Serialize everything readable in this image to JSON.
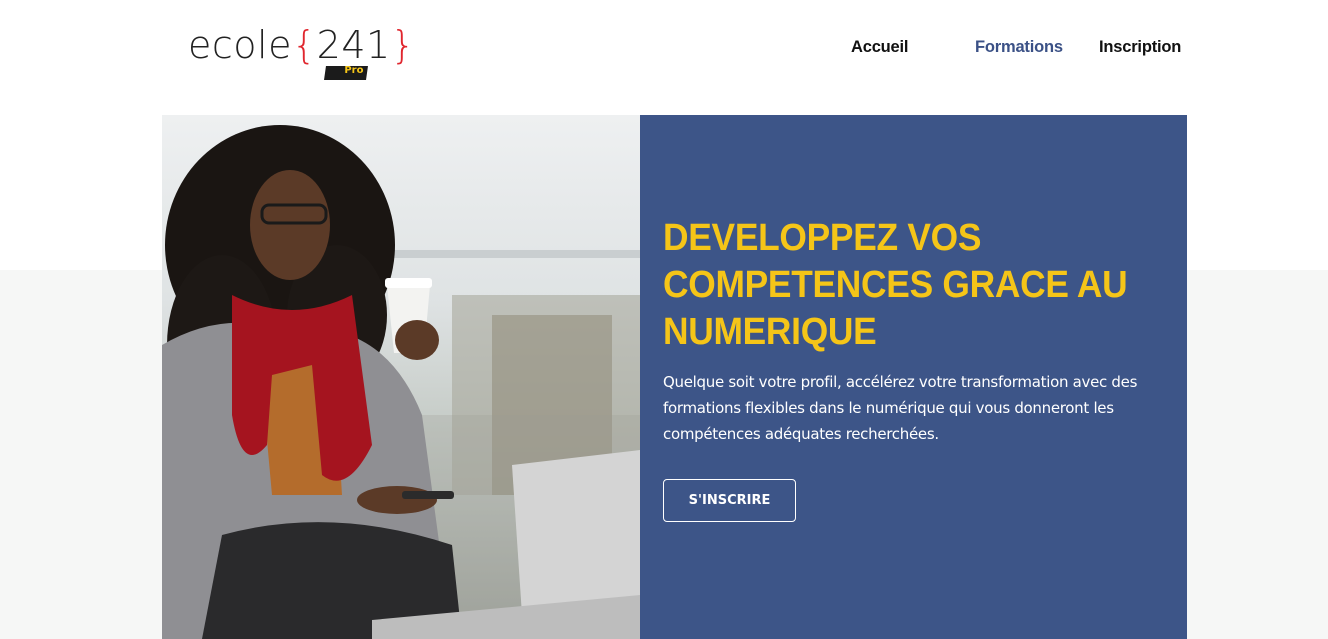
{
  "logo": {
    "word": "ecole",
    "brace_open": "{",
    "number": "241",
    "brace_close": "}",
    "badge": "Pro"
  },
  "nav": {
    "items": [
      {
        "label": "Accueil"
      },
      {
        "label": "Formations"
      },
      {
        "label": "Inscription"
      }
    ]
  },
  "hero": {
    "headline": "DEVELOPPEZ VOS COMPETENCES GRACE AU NUMERIQUE",
    "subtext": "Quelque soit votre profil, accélérez votre transformation avec des formations flexibles dans le numérique qui vous donneront les compétences adéquates recherchées.",
    "cta_label": "S'INSCRIRE"
  },
  "colors": {
    "primary_blue": "#3d5588",
    "accent_yellow": "#f5c518",
    "logo_red": "#e0262e",
    "nav_active": "#3b5186"
  },
  "icons": {
    "logo": "ecole241-pro-logo"
  }
}
